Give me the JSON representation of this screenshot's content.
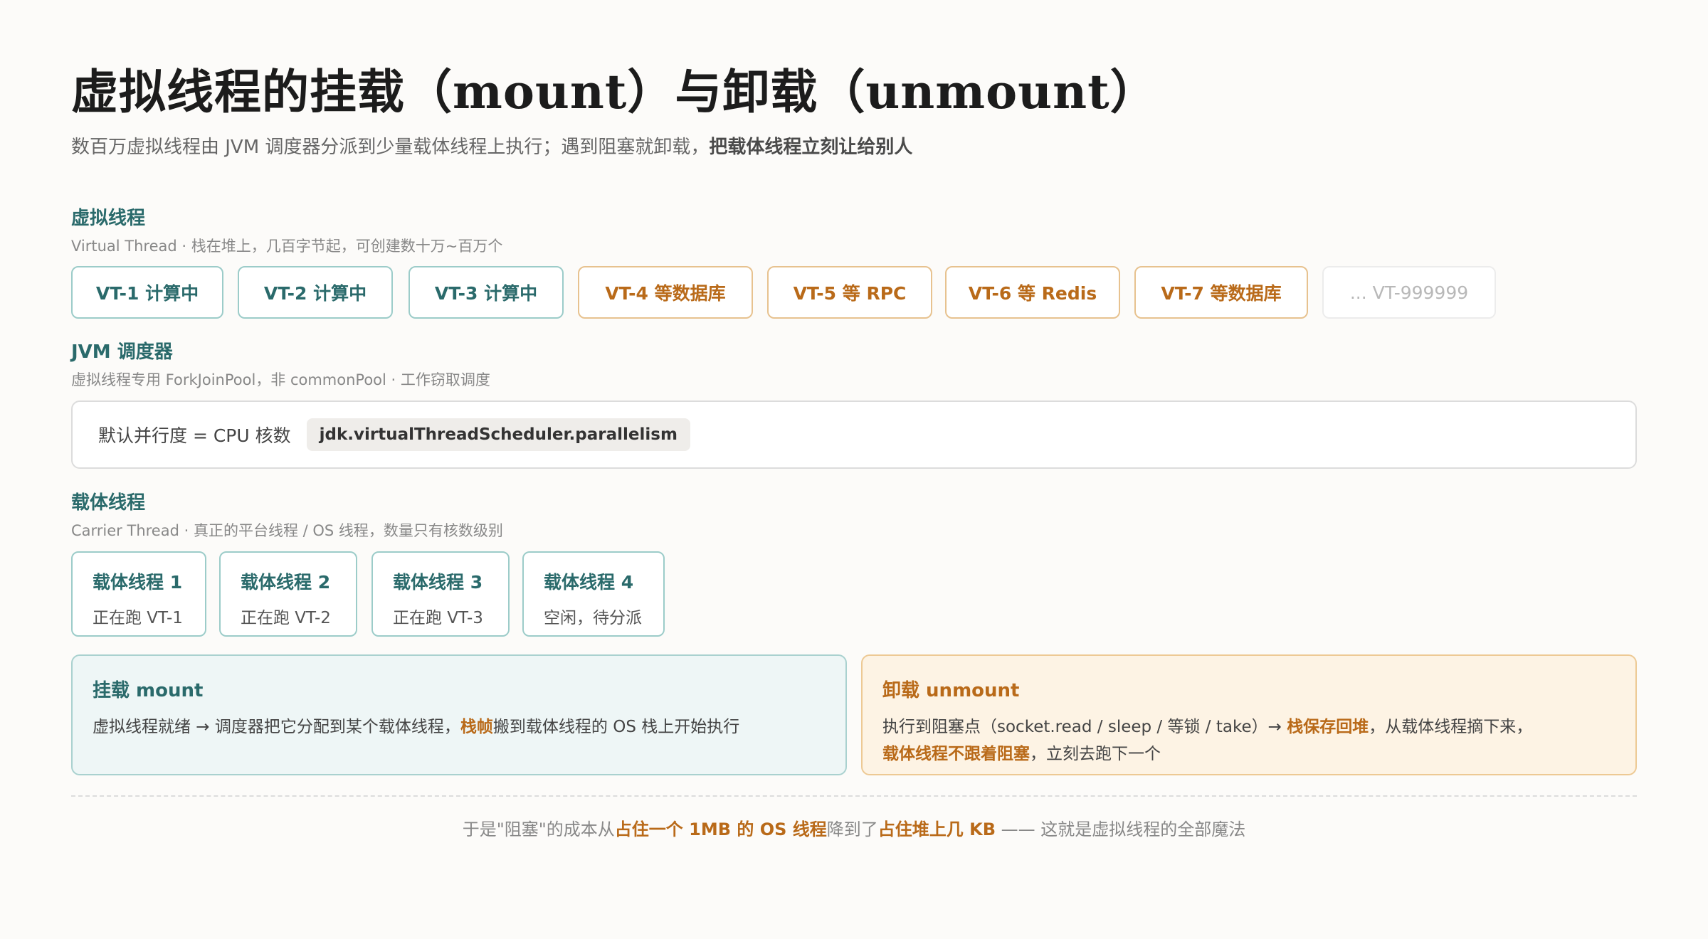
{
  "title": "虚拟线程的挂载（mount）与卸载（unmount）",
  "subtitle": {
    "text": "数百万虚拟线程由 JVM 调度器分派到少量载体线程上执行；遇到阻塞就卸载，",
    "bold": "把载体线程立刻让给别人"
  },
  "virtual_threads": {
    "heading": "虚拟线程",
    "desc": "Virtual Thread · 栈在堆上，几百字节起，可创建数十万~百万个",
    "items": [
      {
        "label": "VT-1 计算中",
        "state": "running"
      },
      {
        "label": "VT-2 计算中",
        "state": "running"
      },
      {
        "label": "VT-3 计算中",
        "state": "running"
      },
      {
        "label": "VT-4 等数据库",
        "state": "waiting"
      },
      {
        "label": "VT-5 等 RPC",
        "state": "waiting"
      },
      {
        "label": "VT-6 等 Redis",
        "state": "waiting"
      },
      {
        "label": "VT-7 等数据库",
        "state": "waiting"
      },
      {
        "label": "... VT-999999",
        "state": "more"
      }
    ]
  },
  "scheduler": {
    "heading": "JVM 调度器",
    "desc": "虚拟线程专用 ForkJoinPool，非 commonPool · 工作窃取调度",
    "text": "默认并行度 = CPU 核数",
    "code": "jdk.virtualThreadScheduler.parallelism"
  },
  "carriers": {
    "heading": "载体线程",
    "desc": "Carrier Thread · 真正的平台线程 / OS 线程，数量只有核数级别",
    "items": [
      {
        "title": "载体线程 1",
        "status": "正在跑 VT-1"
      },
      {
        "title": "载体线程 2",
        "status": "正在跑 VT-2"
      },
      {
        "title": "载体线程 3",
        "status": "正在跑 VT-3"
      },
      {
        "title": "载体线程 4",
        "status": "空闲，待分派"
      }
    ]
  },
  "mount": {
    "heading": "挂载 mount",
    "text_a": "虚拟线程就绪 → 调度器把它分配到某个载体线程，",
    "highlight": "栈帧",
    "text_b": "搬到载体线程的 OS 栈上开始执行"
  },
  "unmount": {
    "heading": "卸载 unmount",
    "text_a": "执行到阻塞点（socket.read / sleep / 等锁 / take）→ ",
    "highlight_a": "栈保存回堆",
    "text_b": "，从载体线程摘下来，",
    "highlight_b": "载体线程不跟着阻塞",
    "text_c": "，立刻去跑下一个"
  },
  "footer": {
    "text_a": "于是\"阻塞\"的成本从",
    "highlight_a": "占住一个 1MB 的 OS 线程",
    "text_b": "降到了",
    "highlight_b": "占住堆上几 KB",
    "text_c": " —— 这就是虚拟线程的全部魔法"
  },
  "colors": {
    "teal": "#2a6a6b",
    "orange": "#b96a19",
    "background": "#fcfbf9"
  }
}
